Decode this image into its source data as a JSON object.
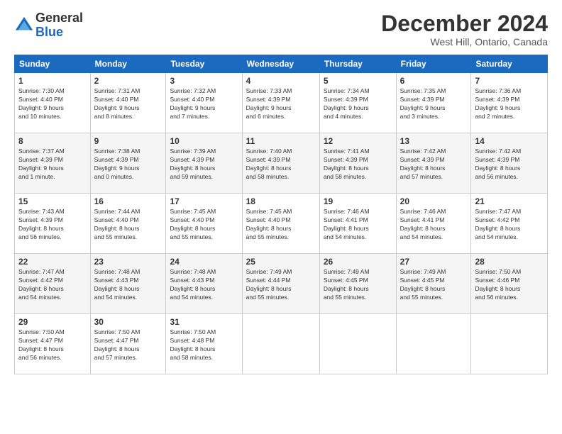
{
  "header": {
    "logo_general": "General",
    "logo_blue": "Blue",
    "month_title": "December 2024",
    "location": "West Hill, Ontario, Canada"
  },
  "days_of_week": [
    "Sunday",
    "Monday",
    "Tuesday",
    "Wednesday",
    "Thursday",
    "Friday",
    "Saturday"
  ],
  "weeks": [
    [
      {
        "day": "1",
        "info": "Sunrise: 7:30 AM\nSunset: 4:40 PM\nDaylight: 9 hours\nand 10 minutes."
      },
      {
        "day": "2",
        "info": "Sunrise: 7:31 AM\nSunset: 4:40 PM\nDaylight: 9 hours\nand 8 minutes."
      },
      {
        "day": "3",
        "info": "Sunrise: 7:32 AM\nSunset: 4:40 PM\nDaylight: 9 hours\nand 7 minutes."
      },
      {
        "day": "4",
        "info": "Sunrise: 7:33 AM\nSunset: 4:39 PM\nDaylight: 9 hours\nand 6 minutes."
      },
      {
        "day": "5",
        "info": "Sunrise: 7:34 AM\nSunset: 4:39 PM\nDaylight: 9 hours\nand 4 minutes."
      },
      {
        "day": "6",
        "info": "Sunrise: 7:35 AM\nSunset: 4:39 PM\nDaylight: 9 hours\nand 3 minutes."
      },
      {
        "day": "7",
        "info": "Sunrise: 7:36 AM\nSunset: 4:39 PM\nDaylight: 9 hours\nand 2 minutes."
      }
    ],
    [
      {
        "day": "8",
        "info": "Sunrise: 7:37 AM\nSunset: 4:39 PM\nDaylight: 9 hours\nand 1 minute."
      },
      {
        "day": "9",
        "info": "Sunrise: 7:38 AM\nSunset: 4:39 PM\nDaylight: 9 hours\nand 0 minutes."
      },
      {
        "day": "10",
        "info": "Sunrise: 7:39 AM\nSunset: 4:39 PM\nDaylight: 8 hours\nand 59 minutes."
      },
      {
        "day": "11",
        "info": "Sunrise: 7:40 AM\nSunset: 4:39 PM\nDaylight: 8 hours\nand 58 minutes."
      },
      {
        "day": "12",
        "info": "Sunrise: 7:41 AM\nSunset: 4:39 PM\nDaylight: 8 hours\nand 58 minutes."
      },
      {
        "day": "13",
        "info": "Sunrise: 7:42 AM\nSunset: 4:39 PM\nDaylight: 8 hours\nand 57 minutes."
      },
      {
        "day": "14",
        "info": "Sunrise: 7:42 AM\nSunset: 4:39 PM\nDaylight: 8 hours\nand 56 minutes."
      }
    ],
    [
      {
        "day": "15",
        "info": "Sunrise: 7:43 AM\nSunset: 4:39 PM\nDaylight: 8 hours\nand 56 minutes."
      },
      {
        "day": "16",
        "info": "Sunrise: 7:44 AM\nSunset: 4:40 PM\nDaylight: 8 hours\nand 55 minutes."
      },
      {
        "day": "17",
        "info": "Sunrise: 7:45 AM\nSunset: 4:40 PM\nDaylight: 8 hours\nand 55 minutes."
      },
      {
        "day": "18",
        "info": "Sunrise: 7:45 AM\nSunset: 4:40 PM\nDaylight: 8 hours\nand 55 minutes."
      },
      {
        "day": "19",
        "info": "Sunrise: 7:46 AM\nSunset: 4:41 PM\nDaylight: 8 hours\nand 54 minutes."
      },
      {
        "day": "20",
        "info": "Sunrise: 7:46 AM\nSunset: 4:41 PM\nDaylight: 8 hours\nand 54 minutes."
      },
      {
        "day": "21",
        "info": "Sunrise: 7:47 AM\nSunset: 4:42 PM\nDaylight: 8 hours\nand 54 minutes."
      }
    ],
    [
      {
        "day": "22",
        "info": "Sunrise: 7:47 AM\nSunset: 4:42 PM\nDaylight: 8 hours\nand 54 minutes."
      },
      {
        "day": "23",
        "info": "Sunrise: 7:48 AM\nSunset: 4:43 PM\nDaylight: 8 hours\nand 54 minutes."
      },
      {
        "day": "24",
        "info": "Sunrise: 7:48 AM\nSunset: 4:43 PM\nDaylight: 8 hours\nand 54 minutes."
      },
      {
        "day": "25",
        "info": "Sunrise: 7:49 AM\nSunset: 4:44 PM\nDaylight: 8 hours\nand 55 minutes."
      },
      {
        "day": "26",
        "info": "Sunrise: 7:49 AM\nSunset: 4:45 PM\nDaylight: 8 hours\nand 55 minutes."
      },
      {
        "day": "27",
        "info": "Sunrise: 7:49 AM\nSunset: 4:45 PM\nDaylight: 8 hours\nand 55 minutes."
      },
      {
        "day": "28",
        "info": "Sunrise: 7:50 AM\nSunset: 4:46 PM\nDaylight: 8 hours\nand 56 minutes."
      }
    ],
    [
      {
        "day": "29",
        "info": "Sunrise: 7:50 AM\nSunset: 4:47 PM\nDaylight: 8 hours\nand 56 minutes."
      },
      {
        "day": "30",
        "info": "Sunrise: 7:50 AM\nSunset: 4:47 PM\nDaylight: 8 hours\nand 57 minutes."
      },
      {
        "day": "31",
        "info": "Sunrise: 7:50 AM\nSunset: 4:48 PM\nDaylight: 8 hours\nand 58 minutes."
      },
      null,
      null,
      null,
      null
    ]
  ]
}
